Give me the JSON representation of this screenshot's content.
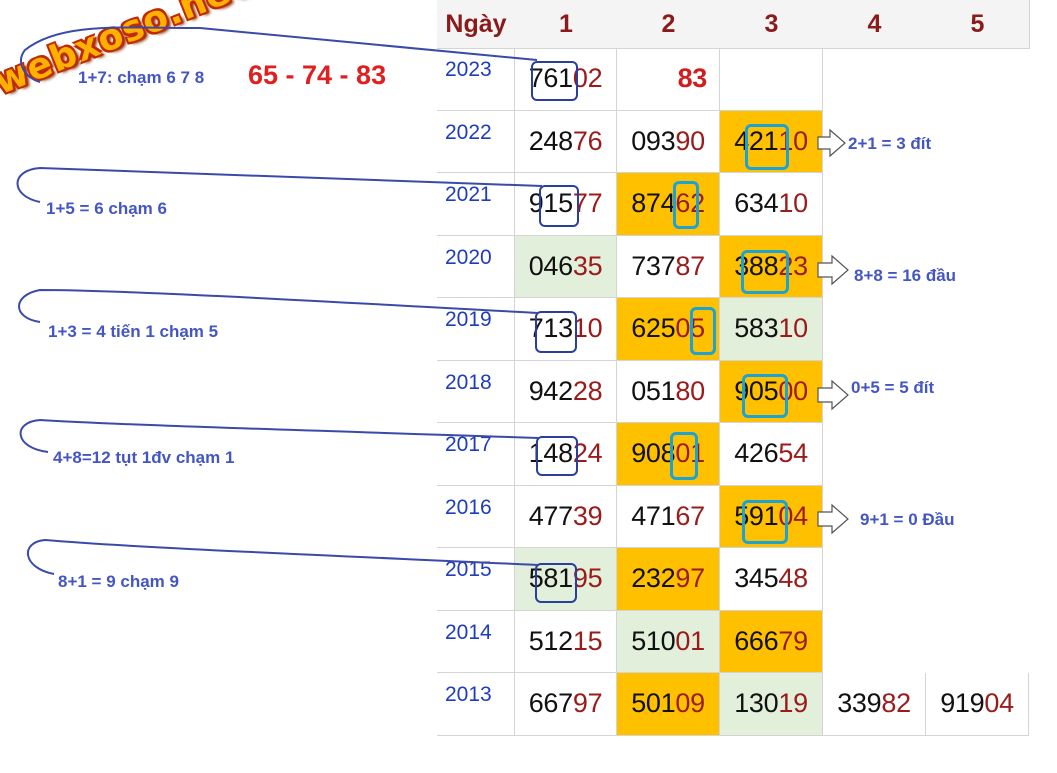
{
  "logo_text": "webxoso.net",
  "top_formula": "1+7: chạm 6 7 8",
  "top_result": "65 - 74 - 83",
  "header": {
    "day_label": "Ngày",
    "cols": [
      "1",
      "2",
      "3",
      "4",
      "5"
    ]
  },
  "rows": [
    {
      "year": "2023",
      "cells": [
        {
          "head": "761",
          "tail": "02"
        },
        {
          "special": "83"
        },
        null,
        null,
        null
      ]
    },
    {
      "year": "2022",
      "cells": [
        {
          "head": "248",
          "tail": "76"
        },
        {
          "head": "093",
          "tail": "90"
        },
        {
          "head": "421",
          "tail": "10"
        },
        null,
        null
      ]
    },
    {
      "year": "2021",
      "cells": [
        {
          "head": "915",
          "tail": "77"
        },
        {
          "head": "874",
          "tail": "62"
        },
        {
          "head": "634",
          "tail": "10"
        },
        null,
        null
      ]
    },
    {
      "year": "2020",
      "cells": [
        {
          "head": "046",
          "tail": "35"
        },
        {
          "head": "737",
          "tail": "87"
        },
        {
          "head": "388",
          "tail": "23"
        },
        null,
        null
      ]
    },
    {
      "year": "2019",
      "cells": [
        {
          "head": "713",
          "tail": "10"
        },
        {
          "head": "625",
          "tail": "05"
        },
        {
          "head": "583",
          "tail": "10"
        },
        null,
        null
      ]
    },
    {
      "year": "2018",
      "cells": [
        {
          "head": "942",
          "tail": "28"
        },
        {
          "head": "051",
          "tail": "80"
        },
        {
          "head": "905",
          "tail": "00"
        },
        null,
        null
      ]
    },
    {
      "year": "2017",
      "cells": [
        {
          "head": "148",
          "tail": "24"
        },
        {
          "head": "908",
          "tail": "01"
        },
        {
          "head": "426",
          "tail": "54"
        },
        null,
        null
      ]
    },
    {
      "year": "2016",
      "cells": [
        {
          "head": "477",
          "tail": "39"
        },
        {
          "head": "471",
          "tail": "67"
        },
        {
          "head": "591",
          "tail": "04"
        },
        null,
        null
      ]
    },
    {
      "year": "2015",
      "cells": [
        {
          "head": "581",
          "tail": "95"
        },
        {
          "head": "232",
          "tail": "97"
        },
        {
          "head": "345",
          "tail": "48"
        },
        null,
        null
      ]
    },
    {
      "year": "2014",
      "cells": [
        {
          "head": "512",
          "tail": "15"
        },
        {
          "head": "510",
          "tail": "01"
        },
        {
          "head": "666",
          "tail": "79"
        },
        null,
        null
      ]
    },
    {
      "year": "2013",
      "cells": [
        {
          "head": "667",
          "tail": "97"
        },
        {
          "head": "501",
          "tail": "09"
        },
        {
          "head": "130",
          "tail": "19"
        },
        {
          "head": "339",
          "tail": "82"
        },
        {
          "head": "919",
          "tail": "04"
        }
      ]
    }
  ],
  "left_notes": [
    "1+5 = 6 chạm 6",
    "1+3 = 4 tiến 1 chạm 5",
    "4+8=12 tụt 1đv chạm 1",
    "8+1 = 9 chạm 9"
  ],
  "right_notes": [
    "2+1 = 3  đít",
    "8+8 = 16 đầu",
    "0+5 = 5  đít",
    "9+1 = 0  Đầu"
  ],
  "colors": {
    "year": "#1f3cbf",
    "tail": "#9b1b1b",
    "highlight_orange": "#ffc000",
    "highlight_green": "#e2efda",
    "note": "#4456c4",
    "result_red": "#e02020"
  }
}
